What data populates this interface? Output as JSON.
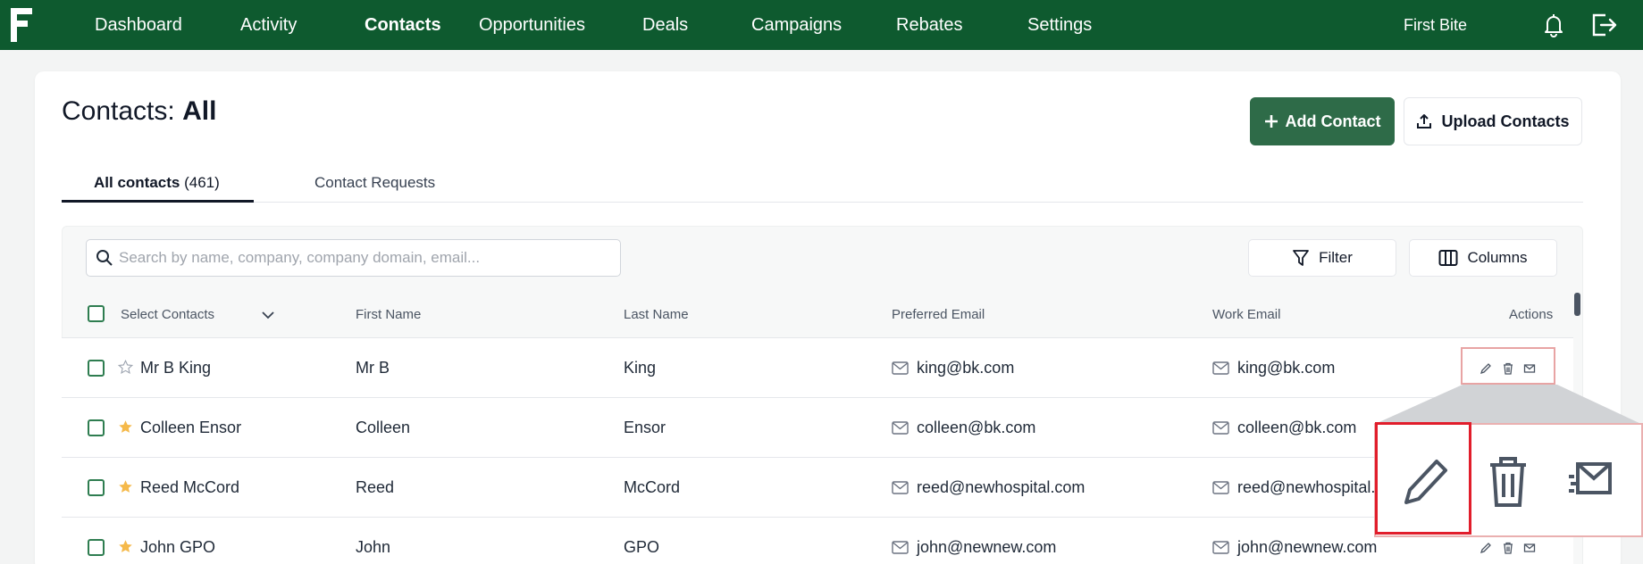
{
  "nav": {
    "items": [
      "Dashboard",
      "Activity",
      "Contacts",
      "Opportunities",
      "Deals",
      "Campaigns",
      "Rebates",
      "Settings"
    ],
    "active_index": 2,
    "brand_name": "First Bite"
  },
  "page": {
    "title_prefix": "Contacts: ",
    "title_strong": "All",
    "add_button": "Add Contact",
    "upload_button": "Upload Contacts"
  },
  "tabs": {
    "all_label": "All contacts",
    "all_count": "(461)",
    "requests_label": "Contact Requests"
  },
  "toolbar": {
    "search_placeholder": "Search by name, company, company domain, email...",
    "filter_label": "Filter",
    "columns_label": "Columns"
  },
  "table": {
    "headers": {
      "select": "Select Contacts",
      "first_name": "First Name",
      "last_name": "Last Name",
      "preferred_email": "Preferred Email",
      "work_email": "Work Email",
      "actions": "Actions"
    },
    "rows": [
      {
        "name": "Mr B King",
        "first": "Mr B",
        "last": "King",
        "preferred": "king@bk.com",
        "work": "king@bk.com",
        "starred": false
      },
      {
        "name": "Colleen Ensor",
        "first": "Colleen",
        "last": "Ensor",
        "preferred": "colleen@bk.com",
        "work": "colleen@bk.com",
        "starred": true
      },
      {
        "name": "Reed McCord",
        "first": "Reed",
        "last": "McCord",
        "preferred": "reed@newhospital.com",
        "work": "reed@newhospital.",
        "starred": true
      },
      {
        "name": "John GPO",
        "first": "John",
        "last": "GPO",
        "preferred": "john@newnew.com",
        "work": "john@newnew.com",
        "starred": true
      }
    ]
  },
  "colors": {
    "nav_bg": "#0e5a2f",
    "primary_button": "#2e6b48",
    "star": "#f5b94a",
    "highlight_red": "#e11d2b"
  },
  "icons": {
    "logo": "brand-f-icon",
    "bell": "bell-icon",
    "logout": "logout-icon",
    "search": "search-icon",
    "filter": "filter-icon",
    "columns": "columns-icon",
    "edit": "pencil-icon",
    "delete": "trash-icon",
    "email": "send-mail-icon"
  }
}
